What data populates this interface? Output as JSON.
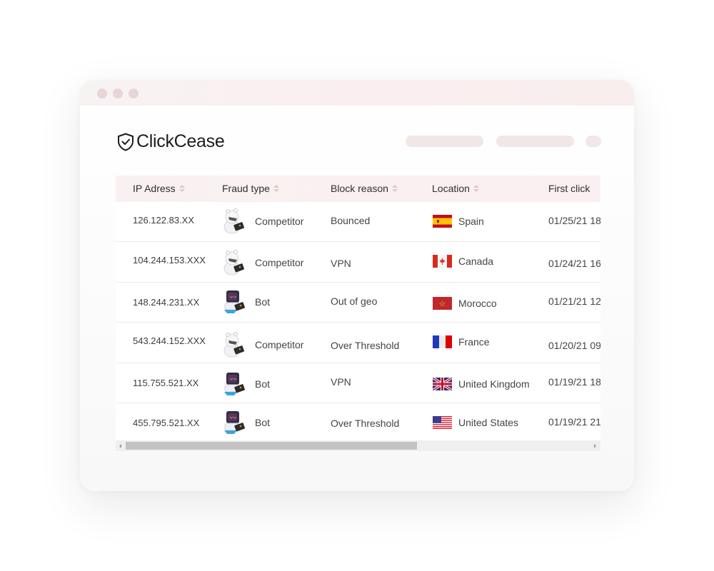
{
  "window": {
    "controls": [
      "close",
      "minimize",
      "maximize"
    ]
  },
  "brand": {
    "name": "ClickCease",
    "logo_icon": "shield-check-icon"
  },
  "colors": {
    "titlebar": "#fbeef0",
    "header_row": "#f9f1f1",
    "placeholder_pill": "#f1e7e7",
    "row_divider": "#f3e8e8"
  },
  "table": {
    "columns": [
      {
        "label": "IP Adress",
        "sortable": true
      },
      {
        "label": "Fraud type",
        "sortable": true
      },
      {
        "label": "Block reason",
        "sortable": true
      },
      {
        "label": "Location",
        "sortable": true
      },
      {
        "label": "First click",
        "sortable": false
      }
    ],
    "rows": [
      {
        "ip": "126.122.83.XX",
        "fraud_type": "Competitor",
        "fraud_icon": "competitor-icon",
        "block_reason": "Bounced",
        "location": "Spain",
        "flag": "spain-flag-icon",
        "first_click": "01/25/21 18"
      },
      {
        "ip": "104.244.153.XXX",
        "fraud_type": "Competitor",
        "fraud_icon": "competitor-icon",
        "block_reason": "VPN",
        "location": "Canada",
        "flag": "canada-flag-icon",
        "first_click": "01/24/21 16"
      },
      {
        "ip": "148.244.231.XX",
        "fraud_type": "Bot",
        "fraud_icon": "bot-icon",
        "block_reason": "Out of geo",
        "location": "Morocco",
        "flag": "morocco-flag-icon",
        "first_click": "01/21/21 12:"
      },
      {
        "ip": "543.244.152.XXX",
        "fraud_type": "Competitor",
        "fraud_icon": "competitor-icon",
        "block_reason": "Over Threshold",
        "location": "France",
        "flag": "france-flag-icon",
        "first_click": "01/20/21 09"
      },
      {
        "ip": "115.755.521.XX",
        "fraud_type": "Bot",
        "fraud_icon": "bot-icon",
        "block_reason": "VPN",
        "location": "United Kingdom",
        "flag": "uk-flag-icon",
        "first_click": "01/19/21 18:"
      },
      {
        "ip": "455.795.521.XX",
        "fraud_type": "Bot",
        "fraud_icon": "bot-icon",
        "block_reason": "Over Threshold",
        "location": "United States",
        "flag": "us-flag-icon",
        "first_click": "01/19/21 21:"
      }
    ],
    "horizontal_scroll_fraction": 0.6
  }
}
